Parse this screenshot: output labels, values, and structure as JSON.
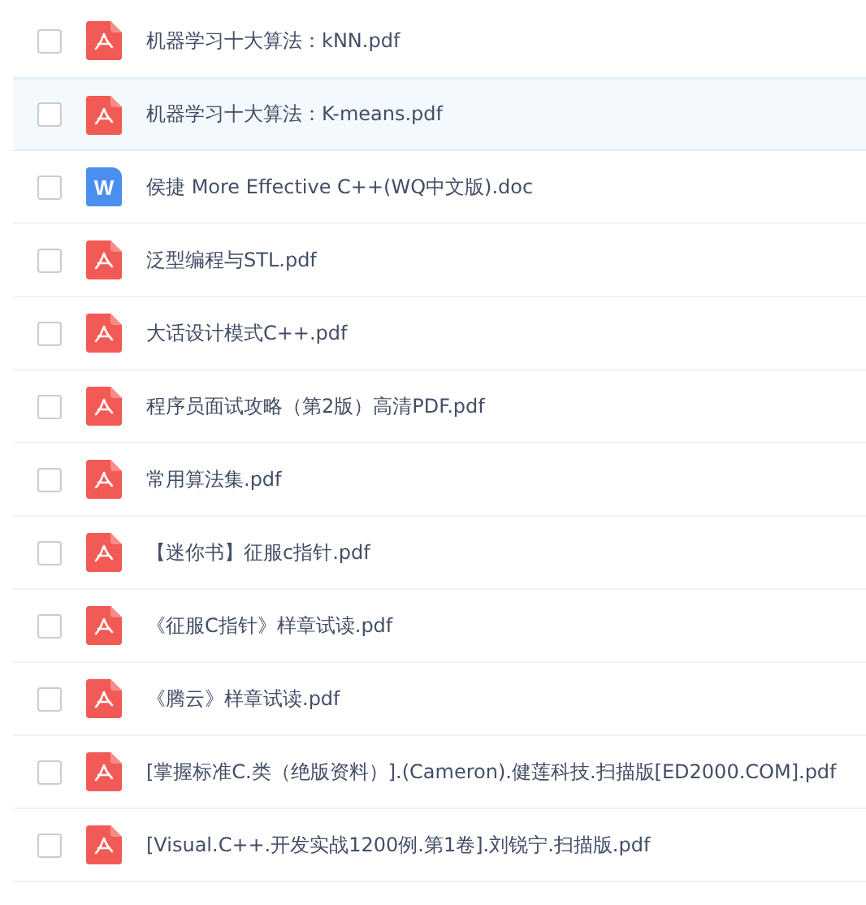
{
  "files": [
    {
      "name": "机器学习十大算法：kNN.pdf",
      "kind": "pdf",
      "checked": false,
      "highlighted": false
    },
    {
      "name": "机器学习十大算法：K-means.pdf",
      "kind": "pdf",
      "checked": false,
      "highlighted": true
    },
    {
      "name": "侯捷 More Effective C++(WQ中文版).doc",
      "kind": "doc",
      "icon_letter": "W",
      "checked": false,
      "highlighted": false
    },
    {
      "name": "泛型编程与STL.pdf",
      "kind": "pdf",
      "checked": false,
      "highlighted": false
    },
    {
      "name": "大话设计模式C++.pdf",
      "kind": "pdf",
      "checked": false,
      "highlighted": false
    },
    {
      "name": "程序员面试攻略（第2版）高清PDF.pdf",
      "kind": "pdf",
      "checked": false,
      "highlighted": false
    },
    {
      "name": "常用算法集.pdf",
      "kind": "pdf",
      "checked": false,
      "highlighted": false
    },
    {
      "name": "【迷你书】征服c指针.pdf",
      "kind": "pdf",
      "checked": false,
      "highlighted": false
    },
    {
      "name": "《征服C指针》样章试读.pdf",
      "kind": "pdf",
      "checked": false,
      "highlighted": false
    },
    {
      "name": "《腾云》样章试读.pdf",
      "kind": "pdf",
      "checked": false,
      "highlighted": false
    },
    {
      "name": "[掌握标准C.类（绝版资料）].(Cameron).健莲科技.扫描版[ED2000.COM].pdf",
      "kind": "pdf",
      "checked": false,
      "highlighted": false
    },
    {
      "name": "[Visual.C++.开发实战1200例.第1卷].刘锐宁.扫描版.pdf",
      "kind": "pdf",
      "checked": false,
      "highlighted": false
    }
  ]
}
